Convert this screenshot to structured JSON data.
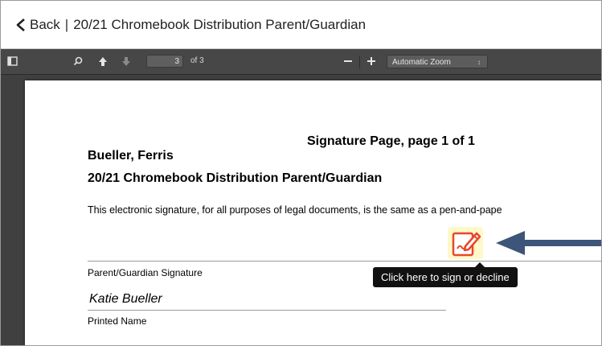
{
  "header": {
    "back_label": "Back",
    "separator": "|",
    "title": "20/21 Chromebook Distribution Parent/Guardian"
  },
  "toolbar": {
    "page_number": "3",
    "page_count_text": "of 3",
    "zoom_minus": "—",
    "zoom_plus": "+",
    "zoom_value": "Automatic Zoom"
  },
  "document": {
    "page_title": "Signature Page, page 1 of 1",
    "person_name": "Bueller, Ferris",
    "form_name": "20/21 Chromebook Distribution Parent/Guardian",
    "legal_text": "This electronic signature, for all purposes of legal documents, is the same as a pen-and-pape",
    "signature_label": "Parent/Guardian Signature",
    "printed_name_value": "Katie Bueller",
    "printed_name_label": "Printed Name"
  },
  "sign_action": {
    "tooltip": "Click here to sign or decline",
    "icon": "sign-document-icon"
  },
  "colors": {
    "toolbar_bg": "#474747",
    "viewer_bg": "#404040",
    "sign_icon": "#e8472b",
    "sign_highlight": "#fff8c9",
    "annotation_arrow": "#3d5578"
  }
}
